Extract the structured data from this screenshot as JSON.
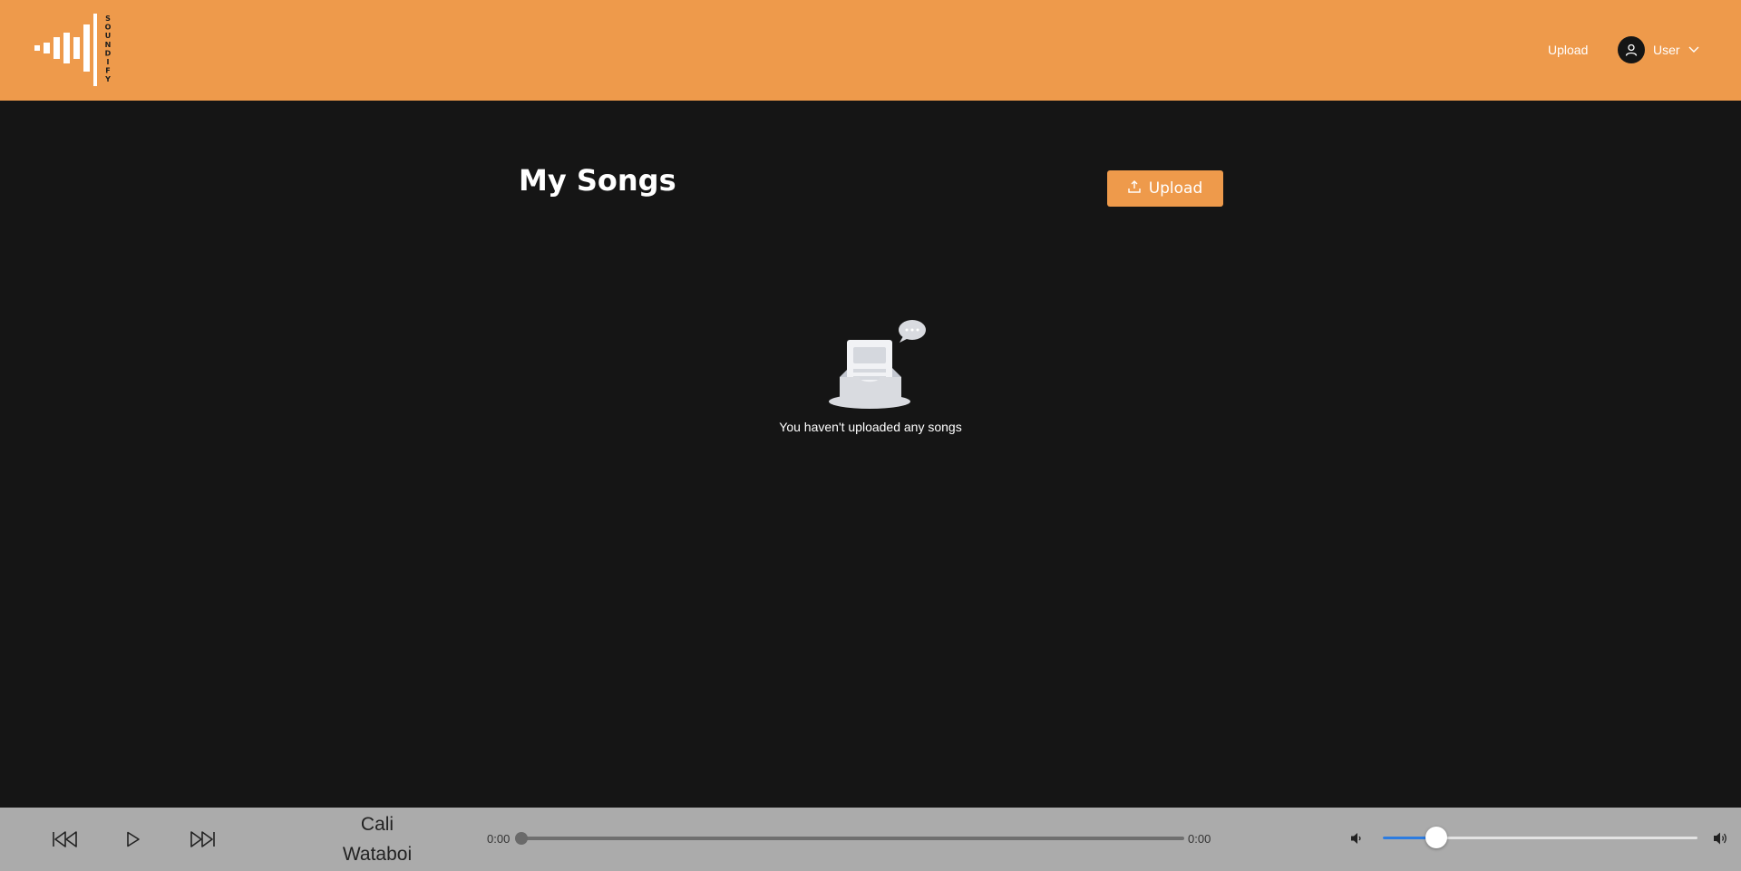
{
  "brand": {
    "name": "SOUNDIFY",
    "logo_icon": "waveform-logo"
  },
  "header": {
    "upload_link": "Upload",
    "user_label": "User",
    "avatar_icon": "user-icon",
    "dropdown_icon": "chevron-down-icon"
  },
  "main": {
    "title": "My Songs",
    "upload_button": "Upload",
    "upload_icon": "upload-icon",
    "empty_message": "You haven't uploaded any songs",
    "empty_icon": "empty-inbox-icon"
  },
  "player": {
    "prev_icon": "skip-back-icon",
    "play_icon": "play-icon",
    "next_icon": "skip-forward-icon",
    "track_title": "Cali",
    "track_artist": "Wataboi",
    "current_time": "0:00",
    "duration": "0:00",
    "progress": 0,
    "volume": 0.17,
    "mute_icon": "volume-low-icon",
    "max_icon": "volume-high-icon"
  },
  "colors": {
    "accent": "#EE9A4B",
    "background": "#151515",
    "player_bg": "#ABABAB",
    "volume_fill": "#2D7CE0"
  }
}
